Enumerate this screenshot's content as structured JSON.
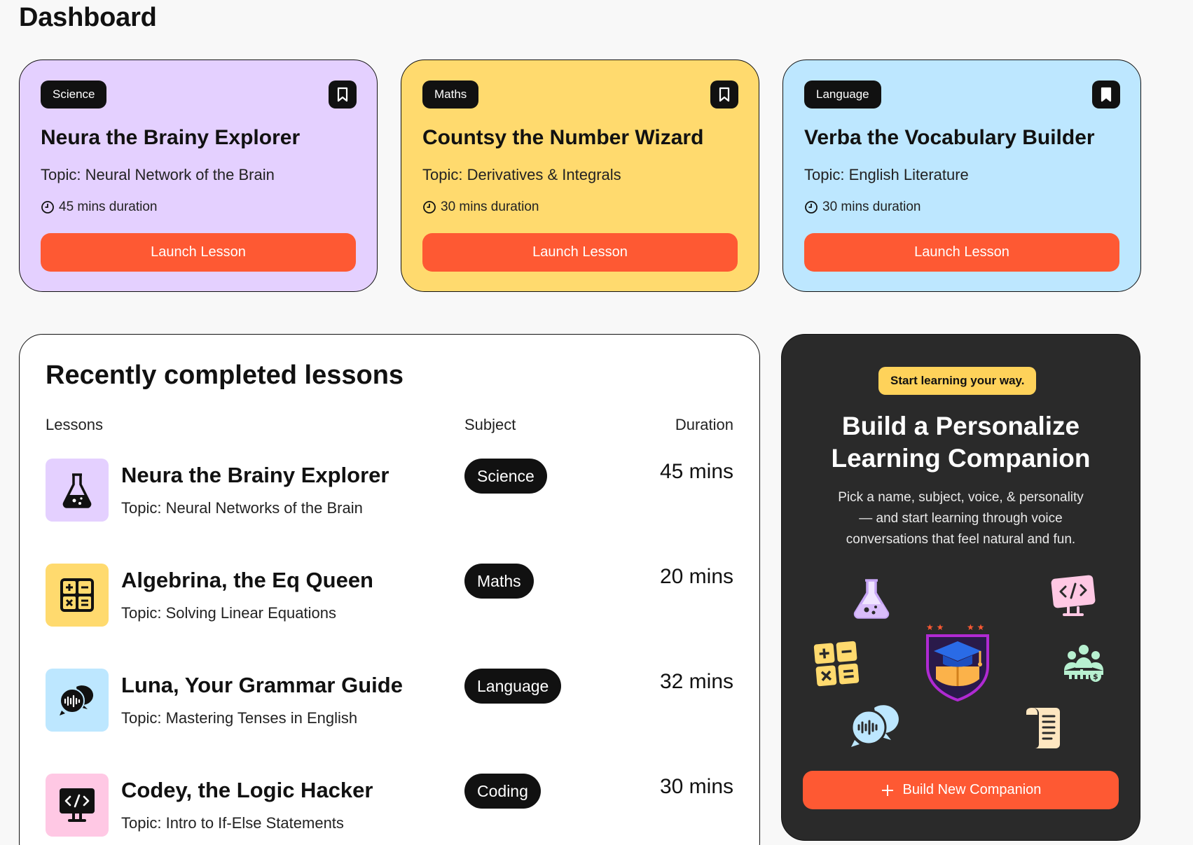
{
  "page_title": "Dashboard",
  "cards": [
    {
      "tag": "Science",
      "title": "Neura the Brainy Explorer",
      "topic": "Topic: Neural Network of the Brain",
      "duration": "45 mins duration",
      "button": "Launch Lesson",
      "bg": "#e4d0ff"
    },
    {
      "tag": "Maths",
      "title": "Countsy the Number Wizard",
      "topic": "Topic: Derivatives & Integrals",
      "duration": "30 mins duration",
      "button": "Launch Lesson",
      "bg": "#ffda6e"
    },
    {
      "tag": "Language",
      "title": "Verba the Vocabulary Builder",
      "topic": "Topic: English Literature",
      "duration": "30 mins duration",
      "button": "Launch Lesson",
      "bg": "#bde7ff"
    }
  ],
  "recent": {
    "heading": "Recently completed lessons",
    "columns": {
      "lessons": "Lessons",
      "subject": "Subject",
      "duration": "Duration"
    },
    "rows": [
      {
        "title": "Neura the Brainy Explorer",
        "topic": "Topic: Neural Networks of the Brain",
        "subject": "Science",
        "duration": "45 mins",
        "icon": "flask-icon",
        "color": "#e4d0ff"
      },
      {
        "title": "Algebrina, the Eq Queen",
        "topic": "Topic: Solving Linear Equations",
        "subject": "Maths",
        "duration": "20 mins",
        "icon": "calculator-icon",
        "color": "#ffda6e"
      },
      {
        "title": "Luna, Your Grammar Guide",
        "topic": "Topic: Mastering Tenses in English",
        "subject": "Language",
        "duration": "32 mins",
        "icon": "chat-bubbles-icon",
        "color": "#bde7ff"
      },
      {
        "title": "Codey, the Logic Hacker",
        "topic": "Topic: Intro to If-Else Statements",
        "subject": "Coding",
        "duration": "30 mins",
        "icon": "code-monitor-icon",
        "color": "#ffc8e4"
      }
    ]
  },
  "cta": {
    "pill": "Start learning your way.",
    "title_line1": "Build a Personalize",
    "title_line2": "Learning Companion",
    "desc_line1": "Pick a name, subject, voice, & personality",
    "desc_line2": "— and start learning through voice",
    "desc_line3": "conversations that feel natural and fun.",
    "button": "Build New Companion",
    "button_icon": "plus-icon"
  },
  "colors": {
    "accent": "#fe5933",
    "dark": "#111111",
    "panel": "#2a2a2a",
    "yellow": "#fed25a"
  }
}
